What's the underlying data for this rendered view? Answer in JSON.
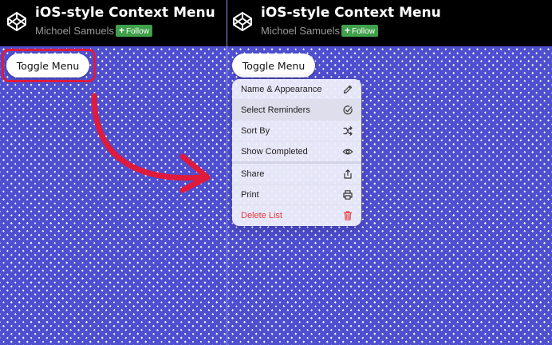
{
  "left": {
    "header": {
      "title": "iOS-style Context Menu",
      "author": "Michoel Samuels",
      "follow_label": "Follow"
    },
    "toggle_label": "Toggle Menu"
  },
  "right": {
    "header": {
      "title": "iOS-style Context Menu",
      "author": "Michoel Samuels",
      "follow_label": "Follow"
    },
    "toggle_label": "Toggle Menu",
    "menu": {
      "items": [
        {
          "label": "Name & Appearance",
          "icon": "pencil-icon"
        },
        {
          "label": "Select Reminders",
          "icon": "check-circle-icon",
          "highlighted": true
        },
        {
          "label": "Sort By",
          "icon": "shuffle-icon"
        },
        {
          "label": "Show Completed",
          "icon": "eye-icon"
        },
        {
          "label": "Share",
          "icon": "share-icon"
        },
        {
          "label": "Print",
          "icon": "printer-icon"
        },
        {
          "label": "Delete List",
          "icon": "trash-icon",
          "destructive": true
        }
      ]
    }
  },
  "colors": {
    "header_bg": "#000000",
    "follow_bg": "#3fa14a",
    "pattern": "#4f4fd0",
    "highlight_stroke": "#e01a3c",
    "destructive": "#e23b3b"
  }
}
